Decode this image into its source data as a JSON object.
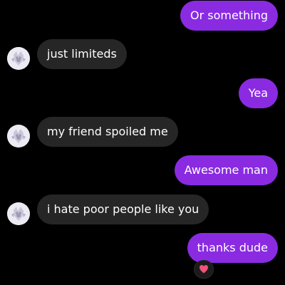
{
  "colors": {
    "background": "#000000",
    "outgoing_bubble": "#8a2be2",
    "incoming_bubble": "#262626",
    "text": "#ffffff",
    "heart": "#f0527a"
  },
  "messages": [
    {
      "direction": "outgoing",
      "text": "Or something"
    },
    {
      "direction": "incoming",
      "text": "just limiteds",
      "avatar": "contact-avatar"
    },
    {
      "direction": "outgoing",
      "text": "Yea"
    },
    {
      "direction": "incoming",
      "text": "my friend spoiled me",
      "avatar": "contact-avatar"
    },
    {
      "direction": "outgoing",
      "text": "Awesome man"
    },
    {
      "direction": "incoming",
      "text": "i hate poor people like you",
      "avatar": "contact-avatar"
    },
    {
      "direction": "outgoing",
      "text": "thanks dude",
      "reaction": "heart-icon"
    }
  ]
}
